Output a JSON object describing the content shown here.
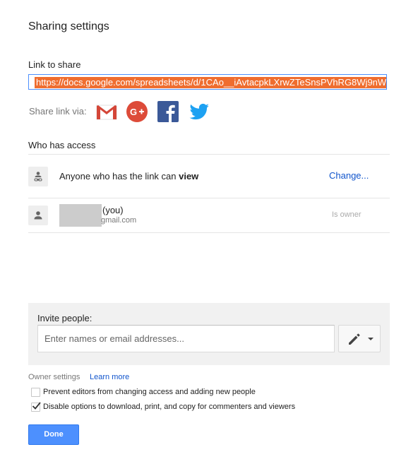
{
  "dialog": {
    "title": "Sharing settings"
  },
  "link_section": {
    "label": "Link to share",
    "url": "https://docs.google.com/spreadsheets/d/1CAo__iAvtacpkLXrwZTeSnsPVhRG8Wj9nW"
  },
  "share_via": {
    "label": "Share link via:",
    "services": [
      {
        "name": "Gmail",
        "icon": "gmail-icon",
        "color": "#d44638"
      },
      {
        "name": "Google+",
        "icon": "google-plus-icon",
        "color": "#dd4b39"
      },
      {
        "name": "Facebook",
        "icon": "facebook-icon",
        "color": "#3b5998"
      },
      {
        "name": "Twitter",
        "icon": "twitter-icon",
        "color": "#1da1f2"
      }
    ]
  },
  "access": {
    "label": "Who has access",
    "link_row": {
      "text_prefix": "Anyone who has the link can ",
      "permission": "view",
      "change_label": "Change..."
    },
    "owner_row": {
      "you_label": "(you)",
      "email": "gmail.com",
      "role": "Is owner"
    }
  },
  "invite": {
    "label": "Invite people:",
    "placeholder": "Enter names or email addresses...",
    "permission_icon": "pencil-icon"
  },
  "owner_settings": {
    "label": "Owner settings",
    "learn_more": "Learn more",
    "options": [
      {
        "label": "Prevent editors from changing access and adding new people",
        "checked": false
      },
      {
        "label": "Disable options to download, print, and copy for commenters and viewers",
        "checked": true
      }
    ]
  },
  "footer": {
    "done_label": "Done"
  },
  "colors": {
    "accent": "#4d90fe",
    "link": "#1155cc",
    "selection": "#ef6d2f"
  }
}
